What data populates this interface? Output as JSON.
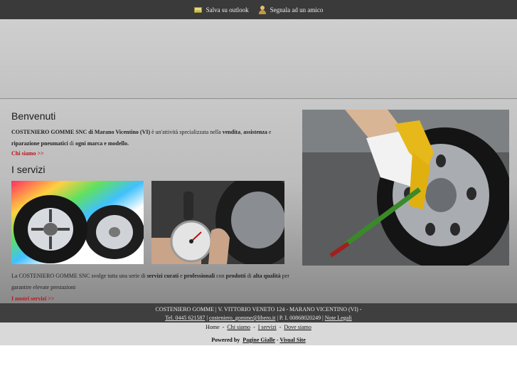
{
  "topbar": {
    "outlook_label": "Salva su outlook",
    "friend_label": "Segnala ad un amico"
  },
  "welcome": {
    "title": "Benvenuti",
    "intro_company": "COSTENIERO GOMME SNC di Marano Vicentino (VI)",
    "intro_text1": " è un'attività specializzata nella ",
    "intro_b1": "vendita",
    "intro_sep1": ", ",
    "intro_b2": "assistenza",
    "intro_text2": " e ",
    "intro_b3": "riparazione pneumatici",
    "intro_text3": " di ",
    "intro_b4": "ogni marca e modello.",
    "link": "Chi siamo >>"
  },
  "services": {
    "title": "I servizi",
    "text1": "La COSTENIERO GOMME SNC svolge tutta una serie di ",
    "b1": "servizi curati",
    "text2": " e ",
    "b2": "professionali",
    "text3": " con ",
    "b3": "prodotti",
    "text4": " di ",
    "b4": "alta qualità",
    "text5": " per garantire elevate prestazioni",
    "link": "I nostri servizi >>"
  },
  "footer": {
    "line1": "COSTENIERO GOMME | V. VITTORIO VENETO 124 - MARANO VICENTINO (VI) -",
    "tel": "Tel. 0445 621587",
    "sep1": " | ",
    "email": "costeniero_gomme@libero.it",
    "piva": " | P. I. 00868020249 | ",
    "legal": "Note Legali"
  },
  "nav": {
    "home": "Home",
    "dash1": "  -  ",
    "chi_siamo": "Chi siamo",
    "dash2": "  -  ",
    "servizi": "I servizi",
    "dash3": "  -  ",
    "dove": "Dove siamo"
  },
  "powered": {
    "label": "Powered by  ",
    "pg": "Pagine Gialle",
    "dash": " - ",
    "vs": "Visual Site"
  }
}
